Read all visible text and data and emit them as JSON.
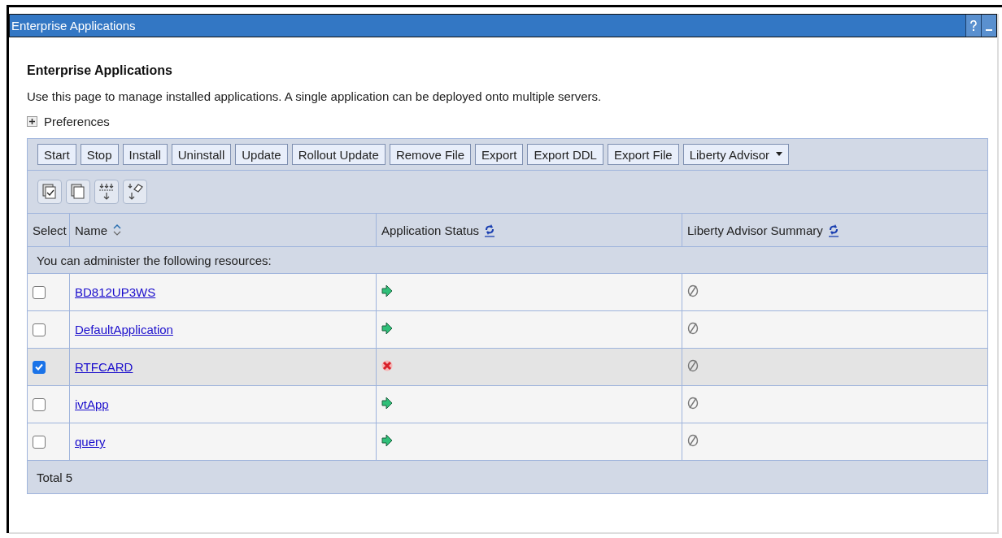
{
  "window": {
    "title": "Enterprise Applications"
  },
  "page": {
    "heading": "Enterprise Applications",
    "description": "Use this page to manage installed applications. A single application can be deployed onto multiple servers.",
    "preferences": {
      "label": "Preferences",
      "expanded": false
    }
  },
  "toolbar": [
    {
      "label": "Start",
      "kind": "button"
    },
    {
      "label": "Stop",
      "kind": "button"
    },
    {
      "label": "Install",
      "kind": "button"
    },
    {
      "label": "Uninstall",
      "kind": "button"
    },
    {
      "label": "Update",
      "kind": "button"
    },
    {
      "label": "Rollout Update",
      "kind": "button"
    },
    {
      "label": "Remove File",
      "kind": "button"
    },
    {
      "label": "Export",
      "kind": "button"
    },
    {
      "label": "Export DDL",
      "kind": "button"
    },
    {
      "label": "Export File",
      "kind": "button"
    },
    {
      "label": "Liberty Advisor",
      "kind": "menu"
    }
  ],
  "table": {
    "columns": [
      {
        "label": "Select",
        "kind": "plain"
      },
      {
        "label": "Name",
        "kind": "sort"
      },
      {
        "label": "Application Status",
        "kind": "refresh"
      },
      {
        "label": "Liberty Advisor Summary",
        "kind": "refresh"
      }
    ],
    "info": "You can administer the following resources:",
    "rows": [
      {
        "name": "BD812UP3WS",
        "checked": false,
        "kind": "running"
      },
      {
        "name": "DefaultApplication",
        "checked": false,
        "kind": "running"
      },
      {
        "name": "RTFCARD",
        "checked": true,
        "kind": "stopped"
      },
      {
        "name": "ivtApp",
        "checked": false,
        "kind": "running"
      },
      {
        "name": "query",
        "checked": false,
        "kind": "running"
      }
    ],
    "total": "Total 5"
  }
}
